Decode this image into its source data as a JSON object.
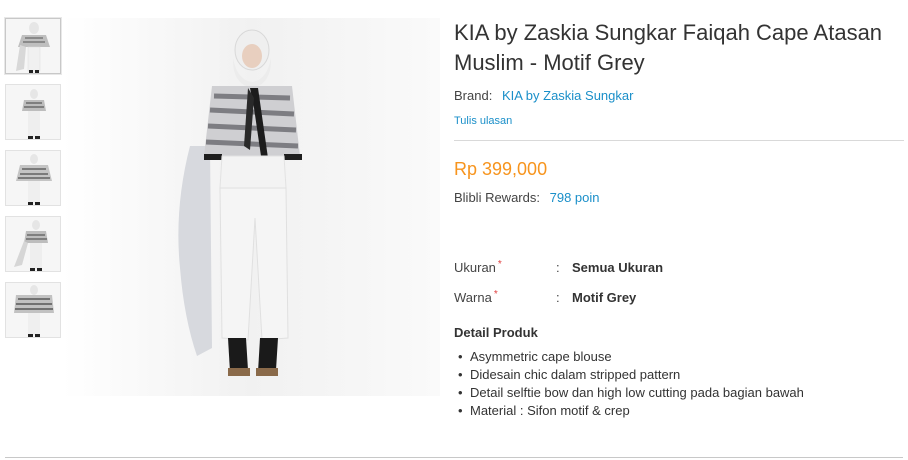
{
  "product": {
    "title": "KIA by Zaskia Sungkar Faiqah Cape Atasan Muslim - Motif Grey",
    "brand_label": "Brand:",
    "brand_name": "KIA by Zaskia Sungkar",
    "review_link": "Tulis ulasan",
    "price": "Rp 399,000",
    "rewards_label": "Blibli Rewards:",
    "rewards_points": "798 poin"
  },
  "attributes": [
    {
      "label": "Ukuran",
      "required": "*",
      "colon": ":",
      "value": "Semua Ukuran"
    },
    {
      "label": "Warna",
      "required": "*",
      "colon": ":",
      "value": "Motif Grey"
    }
  ],
  "details": {
    "heading": "Detail Produk",
    "items": [
      "Asymmetric cape blouse",
      "Didesain chic dalam stripped pattern",
      "Detail selftie bow dan high low cutting pada bagian bawah",
      "Material : Sifon motif & crep"
    ]
  },
  "gallery": {
    "thumbnail_count": 5,
    "selected_index": 0
  },
  "colors": {
    "price": "#f7941d",
    "link": "#1a8fc9",
    "required": "#e04040"
  }
}
